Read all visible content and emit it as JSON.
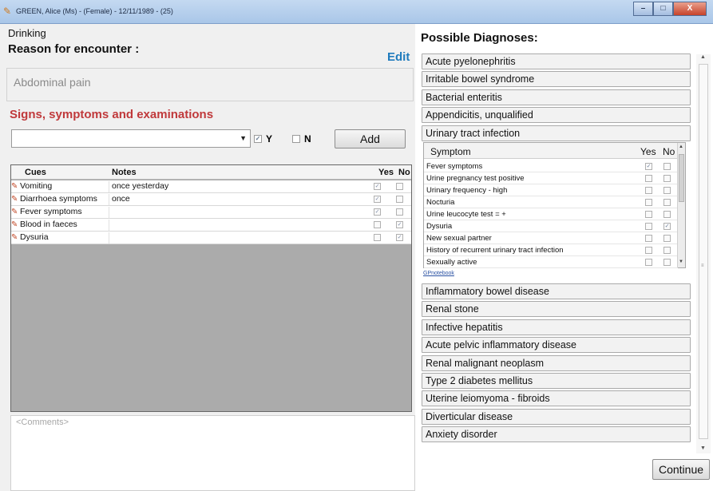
{
  "window": {
    "title": "GREEN, Alice (Ms) - (Female) - 12/11/1989 - (25)",
    "buttons": {
      "minimize": "–",
      "maximize": "□",
      "close": "X"
    }
  },
  "left": {
    "context": "Drinking",
    "reason_title": "Reason for encounter :",
    "edit_label": "Edit",
    "reason_value": "Abdominal pain",
    "signs_title": "Signs, symptoms and examinations",
    "combo_value": "",
    "y_label": "Y",
    "n_label": "N",
    "add_label": "Add",
    "grid": {
      "headers": {
        "cues": "Cues",
        "notes": "Notes",
        "yes": "Yes",
        "no": "No"
      },
      "rows": [
        {
          "cue": "Vomiting",
          "note": "once yesterday",
          "yes": true,
          "no": false
        },
        {
          "cue": "Diarrhoea symptoms",
          "note": "once",
          "yes": true,
          "no": false
        },
        {
          "cue": "Fever symptoms",
          "note": "",
          "yes": true,
          "no": false
        },
        {
          "cue": "Blood in faeces",
          "note": "",
          "yes": false,
          "no": true
        },
        {
          "cue": "Dysuria",
          "note": "",
          "yes": false,
          "no": true
        }
      ]
    },
    "comments_placeholder": "<Comments>"
  },
  "right": {
    "title": "Possible Diagnoses:",
    "diagnoses_top": [
      "Acute pyelonephritis",
      "Irritable bowel syndrome",
      "Bacterial enteritis",
      "Appendicitis, unqualified",
      "Urinary tract infection"
    ],
    "symptom_panel": {
      "headers": {
        "symptom": "Symptom",
        "yes": "Yes",
        "no": "No"
      },
      "rows": [
        {
          "label": "Fever symptoms",
          "yes": true,
          "no": false
        },
        {
          "label": "Urine pregnancy test positive",
          "yes": false,
          "no": false
        },
        {
          "label": "Urinary frequency - high",
          "yes": false,
          "no": false
        },
        {
          "label": "Nocturia",
          "yes": false,
          "no": false
        },
        {
          "label": "Urine leucocyte test = +",
          "yes": false,
          "no": false
        },
        {
          "label": "Dysuria",
          "yes": false,
          "no": true
        },
        {
          "label": "New sexual partner",
          "yes": false,
          "no": false
        },
        {
          "label": "History of recurrent urinary tract infection",
          "yes": false,
          "no": false
        },
        {
          "label": "Sexually active",
          "yes": false,
          "no": false
        }
      ],
      "link": "GPnotebook"
    },
    "diagnoses_bottom": [
      "Inflammatory bowel disease",
      "Renal stone",
      "Infective hepatitis",
      "Acute pelvic inflammatory disease",
      "Renal malignant neoplasm",
      "Type 2 diabetes mellitus",
      "Uterine leiomyoma - fibroids",
      "Diverticular disease",
      "Anxiety disorder"
    ],
    "continue_label": "Continue"
  }
}
